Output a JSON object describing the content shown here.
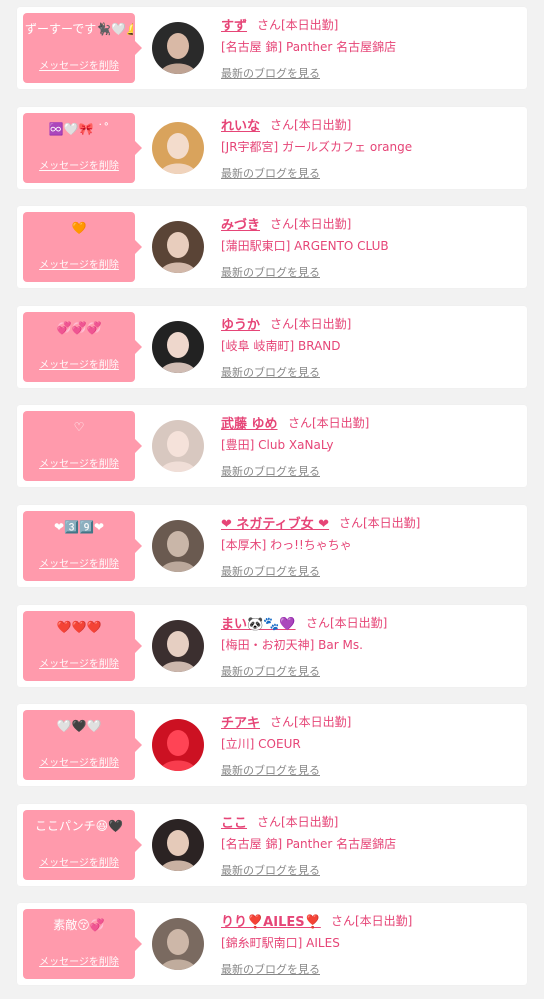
{
  "delete_label": "メッセージを削除",
  "blog_label": "最新のブログを見る",
  "colors": {
    "accent": "#e64577",
    "bubble": "#ff9aac",
    "link_gray": "#888888"
  },
  "entries": [
    {
      "message": "ずーすーです🐈‍⬛🤍🔔",
      "name": "すず",
      "suffix": "さん[本日出勤]",
      "shop": "[名古屋 錦] Panther 名古屋錦店"
    },
    {
      "message": "♾️🤍🎀 ˙˚",
      "name": "れいな",
      "suffix": "さん[本日出勤]",
      "shop": "[JR宇都宮] ガールズカフェ orange"
    },
    {
      "message": "🧡",
      "name": "みづき",
      "suffix": "さん[本日出勤]",
      "shop": "[蒲田駅東口] ARGENTO CLUB"
    },
    {
      "message": "💞💞💞",
      "name": "ゆうか",
      "suffix": "さん[本日出勤]",
      "shop": "[岐阜 岐南町] BRAND"
    },
    {
      "message": "♡",
      "name": "武藤 ゆめ",
      "suffix": "さん[本日出勤]",
      "shop": "[豊田] Club XaNaLy"
    },
    {
      "message": "❤3️⃣9️⃣❤",
      "name": "❤ ネガティブ女 ❤",
      "suffix": "さん[本日出勤]",
      "shop": "[本厚木] わっ!!ちゃちゃ"
    },
    {
      "message": "❤️❤️❤️",
      "name": "まい🐼🐾💜",
      "suffix": "さん[本日出勤]",
      "shop": "[梅田・お初天神] Bar Ms."
    },
    {
      "message": "🤍🖤🤍",
      "name": "チアキ",
      "suffix": "さん[本日出勤]",
      "shop": "[立川] COEUR"
    },
    {
      "message": "ここパンチ😆🖤",
      "name": "ここ",
      "suffix": "さん[本日出勤]",
      "shop": "[名古屋 錦] Panther 名古屋錦店"
    },
    {
      "message": "素敵😚💞",
      "name": "りり❣️AILES❣️",
      "suffix": "さん[本日出勤]",
      "shop": "[錦糸町駅南口] AILES"
    }
  ]
}
